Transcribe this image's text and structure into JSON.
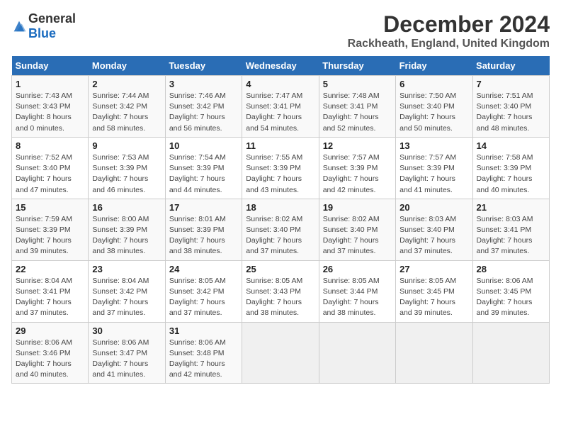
{
  "header": {
    "logo_general": "General",
    "logo_blue": "Blue",
    "title": "December 2024",
    "subtitle": "Rackheath, England, United Kingdom"
  },
  "days_of_week": [
    "Sunday",
    "Monday",
    "Tuesday",
    "Wednesday",
    "Thursday",
    "Friday",
    "Saturday"
  ],
  "weeks": [
    [
      {
        "day": "1",
        "sunrise": "Sunrise: 7:43 AM",
        "sunset": "Sunset: 3:43 PM",
        "daylight": "Daylight: 8 hours and 0 minutes."
      },
      {
        "day": "2",
        "sunrise": "Sunrise: 7:44 AM",
        "sunset": "Sunset: 3:42 PM",
        "daylight": "Daylight: 7 hours and 58 minutes."
      },
      {
        "day": "3",
        "sunrise": "Sunrise: 7:46 AM",
        "sunset": "Sunset: 3:42 PM",
        "daylight": "Daylight: 7 hours and 56 minutes."
      },
      {
        "day": "4",
        "sunrise": "Sunrise: 7:47 AM",
        "sunset": "Sunset: 3:41 PM",
        "daylight": "Daylight: 7 hours and 54 minutes."
      },
      {
        "day": "5",
        "sunrise": "Sunrise: 7:48 AM",
        "sunset": "Sunset: 3:41 PM",
        "daylight": "Daylight: 7 hours and 52 minutes."
      },
      {
        "day": "6",
        "sunrise": "Sunrise: 7:50 AM",
        "sunset": "Sunset: 3:40 PM",
        "daylight": "Daylight: 7 hours and 50 minutes."
      },
      {
        "day": "7",
        "sunrise": "Sunrise: 7:51 AM",
        "sunset": "Sunset: 3:40 PM",
        "daylight": "Daylight: 7 hours and 48 minutes."
      }
    ],
    [
      {
        "day": "8",
        "sunrise": "Sunrise: 7:52 AM",
        "sunset": "Sunset: 3:40 PM",
        "daylight": "Daylight: 7 hours and 47 minutes."
      },
      {
        "day": "9",
        "sunrise": "Sunrise: 7:53 AM",
        "sunset": "Sunset: 3:39 PM",
        "daylight": "Daylight: 7 hours and 46 minutes."
      },
      {
        "day": "10",
        "sunrise": "Sunrise: 7:54 AM",
        "sunset": "Sunset: 3:39 PM",
        "daylight": "Daylight: 7 hours and 44 minutes."
      },
      {
        "day": "11",
        "sunrise": "Sunrise: 7:55 AM",
        "sunset": "Sunset: 3:39 PM",
        "daylight": "Daylight: 7 hours and 43 minutes."
      },
      {
        "day": "12",
        "sunrise": "Sunrise: 7:57 AM",
        "sunset": "Sunset: 3:39 PM",
        "daylight": "Daylight: 7 hours and 42 minutes."
      },
      {
        "day": "13",
        "sunrise": "Sunrise: 7:57 AM",
        "sunset": "Sunset: 3:39 PM",
        "daylight": "Daylight: 7 hours and 41 minutes."
      },
      {
        "day": "14",
        "sunrise": "Sunrise: 7:58 AM",
        "sunset": "Sunset: 3:39 PM",
        "daylight": "Daylight: 7 hours and 40 minutes."
      }
    ],
    [
      {
        "day": "15",
        "sunrise": "Sunrise: 7:59 AM",
        "sunset": "Sunset: 3:39 PM",
        "daylight": "Daylight: 7 hours and 39 minutes."
      },
      {
        "day": "16",
        "sunrise": "Sunrise: 8:00 AM",
        "sunset": "Sunset: 3:39 PM",
        "daylight": "Daylight: 7 hours and 38 minutes."
      },
      {
        "day": "17",
        "sunrise": "Sunrise: 8:01 AM",
        "sunset": "Sunset: 3:39 PM",
        "daylight": "Daylight: 7 hours and 38 minutes."
      },
      {
        "day": "18",
        "sunrise": "Sunrise: 8:02 AM",
        "sunset": "Sunset: 3:40 PM",
        "daylight": "Daylight: 7 hours and 37 minutes."
      },
      {
        "day": "19",
        "sunrise": "Sunrise: 8:02 AM",
        "sunset": "Sunset: 3:40 PM",
        "daylight": "Daylight: 7 hours and 37 minutes."
      },
      {
        "day": "20",
        "sunrise": "Sunrise: 8:03 AM",
        "sunset": "Sunset: 3:40 PM",
        "daylight": "Daylight: 7 hours and 37 minutes."
      },
      {
        "day": "21",
        "sunrise": "Sunrise: 8:03 AM",
        "sunset": "Sunset: 3:41 PM",
        "daylight": "Daylight: 7 hours and 37 minutes."
      }
    ],
    [
      {
        "day": "22",
        "sunrise": "Sunrise: 8:04 AM",
        "sunset": "Sunset: 3:41 PM",
        "daylight": "Daylight: 7 hours and 37 minutes."
      },
      {
        "day": "23",
        "sunrise": "Sunrise: 8:04 AM",
        "sunset": "Sunset: 3:42 PM",
        "daylight": "Daylight: 7 hours and 37 minutes."
      },
      {
        "day": "24",
        "sunrise": "Sunrise: 8:05 AM",
        "sunset": "Sunset: 3:42 PM",
        "daylight": "Daylight: 7 hours and 37 minutes."
      },
      {
        "day": "25",
        "sunrise": "Sunrise: 8:05 AM",
        "sunset": "Sunset: 3:43 PM",
        "daylight": "Daylight: 7 hours and 38 minutes."
      },
      {
        "day": "26",
        "sunrise": "Sunrise: 8:05 AM",
        "sunset": "Sunset: 3:44 PM",
        "daylight": "Daylight: 7 hours and 38 minutes."
      },
      {
        "day": "27",
        "sunrise": "Sunrise: 8:05 AM",
        "sunset": "Sunset: 3:45 PM",
        "daylight": "Daylight: 7 hours and 39 minutes."
      },
      {
        "day": "28",
        "sunrise": "Sunrise: 8:06 AM",
        "sunset": "Sunset: 3:45 PM",
        "daylight": "Daylight: 7 hours and 39 minutes."
      }
    ],
    [
      {
        "day": "29",
        "sunrise": "Sunrise: 8:06 AM",
        "sunset": "Sunset: 3:46 PM",
        "daylight": "Daylight: 7 hours and 40 minutes."
      },
      {
        "day": "30",
        "sunrise": "Sunrise: 8:06 AM",
        "sunset": "Sunset: 3:47 PM",
        "daylight": "Daylight: 7 hours and 41 minutes."
      },
      {
        "day": "31",
        "sunrise": "Sunrise: 8:06 AM",
        "sunset": "Sunset: 3:48 PM",
        "daylight": "Daylight: 7 hours and 42 minutes."
      },
      null,
      null,
      null,
      null
    ]
  ]
}
